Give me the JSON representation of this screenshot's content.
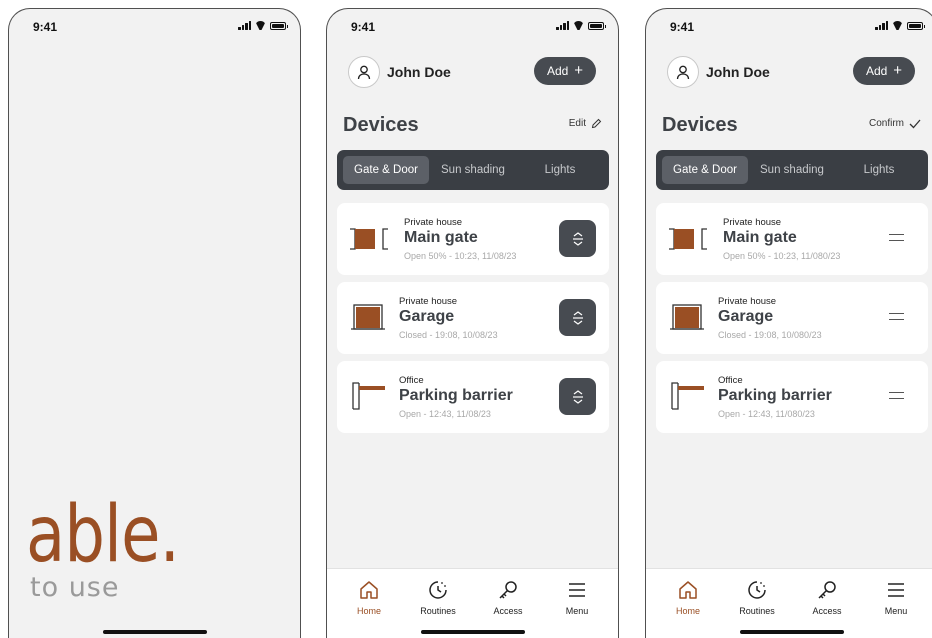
{
  "status_time": "9:41",
  "splash": {
    "brand": "able.",
    "tagline": "to use"
  },
  "header": {
    "user_name": "John Doe",
    "add_label": "Add",
    "add_icon": "plus-icon"
  },
  "devices": {
    "title": "Devices",
    "edit_label": "Edit",
    "confirm_label": "Confirm",
    "tabs": [
      {
        "label": "Gate & Door",
        "active": true
      },
      {
        "label": "Sun shading",
        "active": false
      },
      {
        "label": "Lights",
        "active": false
      }
    ]
  },
  "cards_normal": [
    {
      "location": "Private house",
      "name": "Main gate",
      "status": "Open 50% - 10:23, 11/08/23",
      "icon": "gate-icon"
    },
    {
      "location": "Private house",
      "name": "Garage",
      "status": "Closed - 19:08, 10/08/23",
      "icon": "garage-icon"
    },
    {
      "location": "Office",
      "name": "Parking barrier",
      "status": "Open - 12:43, 11/08/23",
      "icon": "barrier-icon"
    }
  ],
  "cards_edit": [
    {
      "location": "Private house",
      "name": "Main gate",
      "status": "Open 50% - 10:23, 11/080/23"
    },
    {
      "location": "Private house",
      "name": "Garage",
      "status": "Closed - 19:08, 10/080/23"
    },
    {
      "location": "Office",
      "name": "Parking barrier",
      "status": "Open - 12:43, 11/080/23"
    }
  ],
  "nav": [
    {
      "label": "Home",
      "icon": "home-icon",
      "active": true
    },
    {
      "label": "Routines",
      "icon": "clock-icon",
      "active": false
    },
    {
      "label": "Access",
      "icon": "key-icon",
      "active": false
    },
    {
      "label": "Menu",
      "icon": "menu-icon",
      "active": false
    }
  ],
  "colors": {
    "accent": "#9a4f24",
    "dark": "#3a3e44",
    "background": "#f2f2f2"
  }
}
